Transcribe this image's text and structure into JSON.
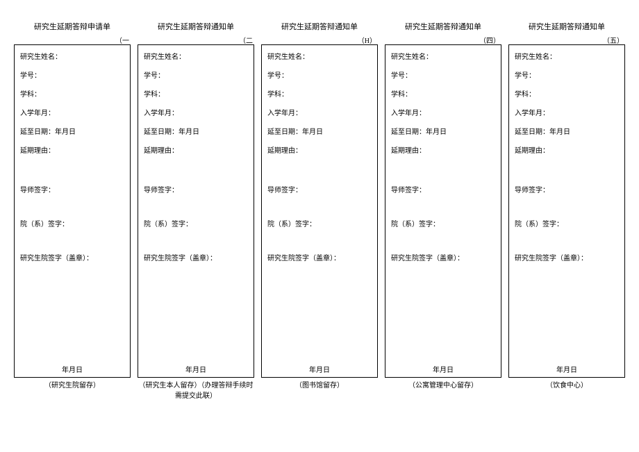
{
  "slips": [
    {
      "title": "研究生延期答辩申请单",
      "pageno": "（一",
      "footer": "（研究生院留存）"
    },
    {
      "title": "研究生延期答辩通知单",
      "pageno": "（二",
      "footer": "（研究生本人留存）（办理答辩手续时需提交此联）"
    },
    {
      "title": "研究生延期答辩通知单",
      "pageno": "（H）",
      "footer": "（图书馆留存）"
    },
    {
      "title": "研究生延期答辩通知单",
      "pageno": "（四）",
      "footer": "（公寓管理中心留存）"
    },
    {
      "title": "研究生延期答辩通知单",
      "pageno": "（五）",
      "footer": "（饮食中心）"
    }
  ],
  "labels": {
    "name": "研究生姓名：",
    "id": "学号：",
    "subject": "学科：",
    "enroll": "入学年月：",
    "delay_to": "延至日期：年月日",
    "reason": "延期理由：",
    "advisor": "导师签字：",
    "dept": "院（系）签字：",
    "grad": "研究生院签字（盖章）：",
    "date_bottom": "年月日"
  }
}
